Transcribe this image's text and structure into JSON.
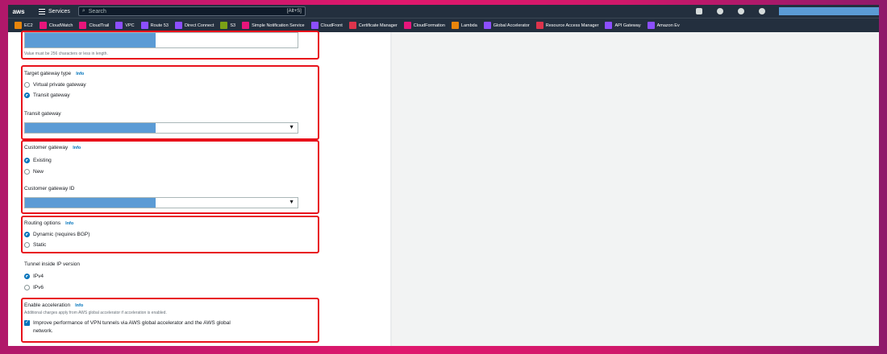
{
  "topnav": {
    "logo": "aws",
    "services_label": "Services",
    "search_placeholder": "Search",
    "search_shortcut": "[Alt+S]"
  },
  "favorites": [
    {
      "label": "EC2",
      "color": "#e8850c"
    },
    {
      "label": "CloudWatch",
      "color": "#e7157b"
    },
    {
      "label": "CloudTrail",
      "color": "#e7157b"
    },
    {
      "label": "VPC",
      "color": "#8c4fff"
    },
    {
      "label": "Route 53",
      "color": "#8c4fff"
    },
    {
      "label": "Direct Connect",
      "color": "#8c4fff"
    },
    {
      "label": "S3",
      "color": "#7aa116"
    },
    {
      "label": "Simple Notification Service",
      "color": "#e7157b"
    },
    {
      "label": "CloudFront",
      "color": "#8c4fff"
    },
    {
      "label": "Certificate Manager",
      "color": "#dd344c"
    },
    {
      "label": "CloudFormation",
      "color": "#e7157b"
    },
    {
      "label": "Lambda",
      "color": "#e8850c"
    },
    {
      "label": "Global Accelerator",
      "color": "#8c4fff"
    },
    {
      "label": "Resource Access Manager",
      "color": "#dd344c"
    },
    {
      "label": "API Gateway",
      "color": "#8c4fff"
    },
    {
      "label": "Amazon Ev",
      "color": "#8c4fff"
    }
  ],
  "form": {
    "name_hint": "Value must be 256 characters or less in length.",
    "target_gateway": {
      "title": "Target gateway type",
      "info": "Info",
      "options": [
        "Virtual private gateway",
        "Transit gateway"
      ],
      "transit_label": "Transit gateway"
    },
    "customer_gateway": {
      "title": "Customer gateway",
      "info": "Info",
      "options": [
        "Existing",
        "New"
      ],
      "id_label": "Customer gateway ID"
    },
    "routing": {
      "title": "Routing options",
      "info": "Info",
      "options": [
        "Dynamic (requires BGP)",
        "Static"
      ]
    },
    "tunnel_ip": {
      "title": "Tunnel inside IP version",
      "options": [
        "IPv4",
        "IPv6"
      ]
    },
    "acceleration": {
      "title": "Enable acceleration",
      "info": "Info",
      "hint": "Additional charges apply from AWS global accelerator if acceleration is enabled.",
      "checkbox_line1": "Improve performance of VPN tunnels via AWS global accelerator and the AWS global",
      "checkbox_line2": "network."
    }
  },
  "colors": {
    "highlight": "#e8111b",
    "redacted": "#5b9bd5",
    "accent": "#0073bb"
  }
}
